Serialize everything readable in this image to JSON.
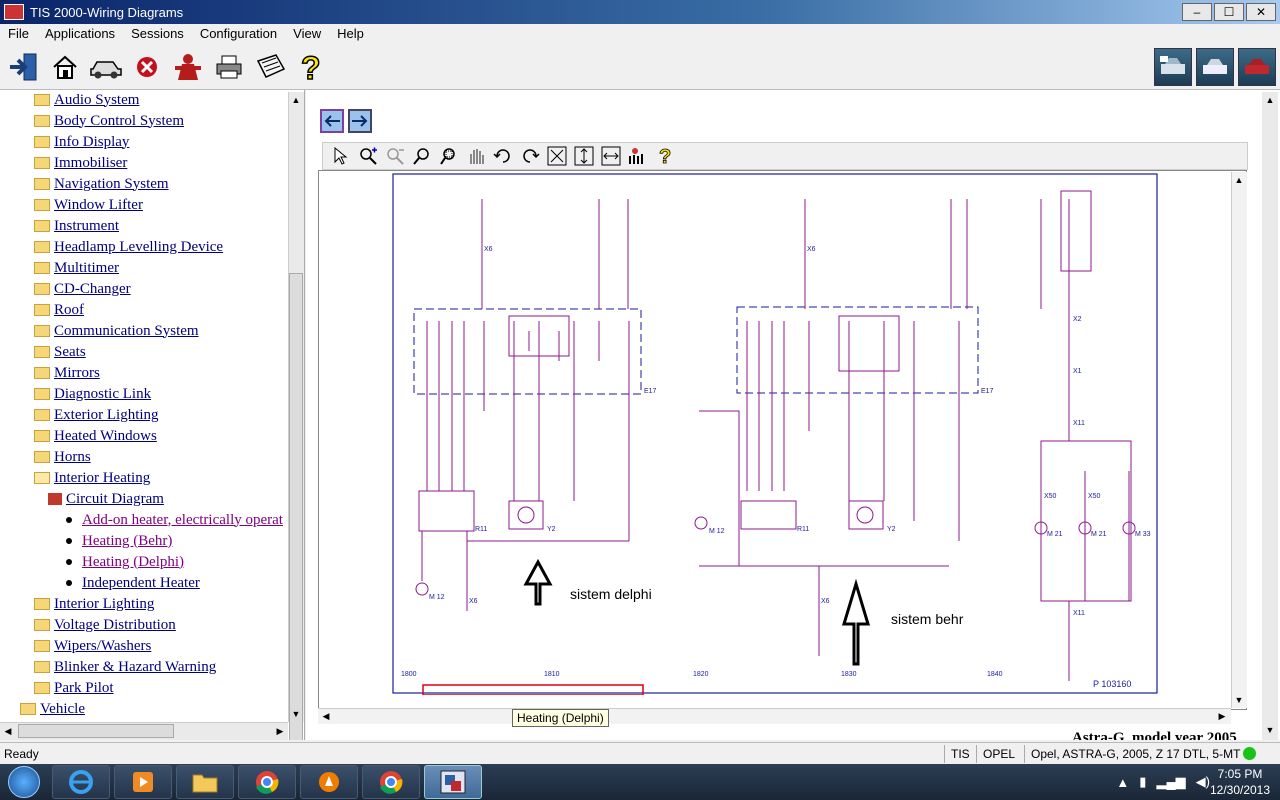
{
  "window": {
    "title_app": "TIS 2000",
    "title_sep": " - ",
    "title_doc": "Wiring Diagrams",
    "min_label": "–",
    "max_label": "☐",
    "close_label": "✕"
  },
  "menu": [
    "File",
    "Applications",
    "Sessions",
    "Configuration",
    "View",
    "Help"
  ],
  "tree": {
    "items": [
      {
        "label": "Audio System"
      },
      {
        "label": "Body Control System"
      },
      {
        "label": "Info Display"
      },
      {
        "label": "Immobiliser"
      },
      {
        "label": "Navigation System"
      },
      {
        "label": "Window Lifter"
      },
      {
        "label": "Instrument"
      },
      {
        "label": "Headlamp Levelling Device"
      },
      {
        "label": "Multitimer"
      },
      {
        "label": "CD-Changer"
      },
      {
        "label": "Roof"
      },
      {
        "label": "Communication System"
      },
      {
        "label": "Seats"
      },
      {
        "label": "Mirrors"
      },
      {
        "label": "Diagnostic Link"
      },
      {
        "label": "Exterior Lighting"
      },
      {
        "label": "Heated Windows"
      },
      {
        "label": "Horns"
      },
      {
        "label": "Interior Heating"
      },
      {
        "label": "Circuit Diagram"
      },
      {
        "label": "Add-on heater, electrically operat"
      },
      {
        "label": "Heating (Behr)"
      },
      {
        "label": "Heating (Delphi)"
      },
      {
        "label": "Independent Heater"
      },
      {
        "label": "Interior Lighting"
      },
      {
        "label": "Voltage Distribution"
      },
      {
        "label": "Wipers/Washers"
      },
      {
        "label": "Blinker & Hazard Warning"
      },
      {
        "label": "Park Pilot"
      },
      {
        "label": "Vehicle"
      }
    ]
  },
  "diagram": {
    "annotations": {
      "delphi": "sistem delphi",
      "behr": "sistem behr"
    },
    "labels": {
      "e17": "E17",
      "r11": "R11",
      "y2": "Y2",
      "m12": "M 12",
      "m21": "M 21",
      "m33": "M 33",
      "x6": "X6",
      "x50": "X50",
      "x1": "X1",
      "x2": "X2",
      "x11": "X11",
      "ref": "P 103160"
    },
    "scale": [
      "1800",
      "1810",
      "1820",
      "1830",
      "1840"
    ]
  },
  "tooltip": "Heating (Delphi)",
  "footer_caption": "Astra-G, model year 2005",
  "status": {
    "ready": "Ready",
    "tis": "TIS",
    "make": "OPEL",
    "vehicle": "Opel, ASTRA-G, 2005, Z 17 DTL, 5-MT"
  },
  "taskbar": {
    "time": "7:05 PM",
    "date": "12/30/2013"
  },
  "colors": {
    "link": "#00007f",
    "visited": "#800080",
    "wire": "#8b1a8b",
    "highlight": "#e0000d"
  }
}
